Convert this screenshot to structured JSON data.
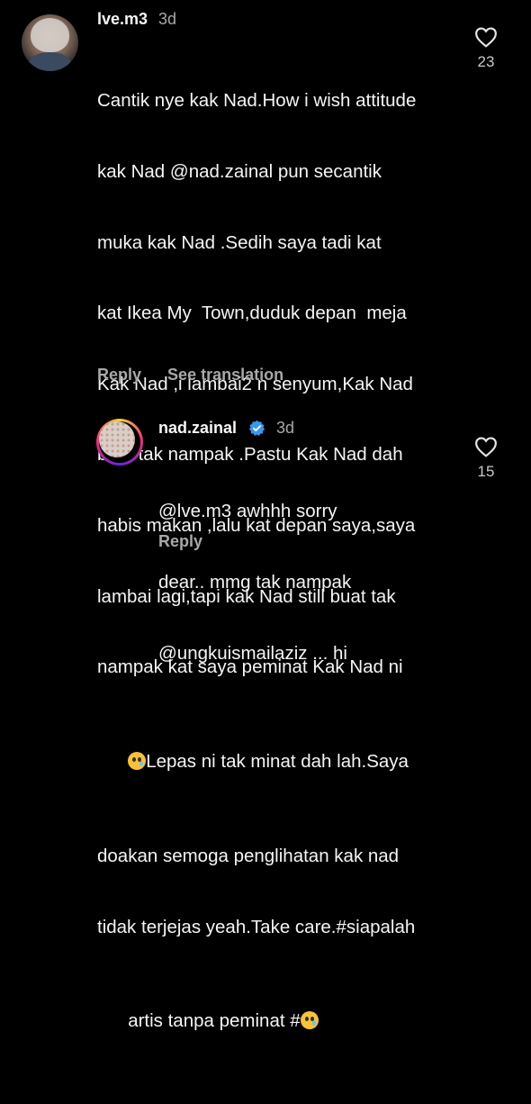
{
  "comment": {
    "username": "lve.m3",
    "time": "3d",
    "text_lines": [
      "Cantik nye kak Nad.How i wish attitude",
      "kak Nad @nad.zainal pun secantik",
      "muka kak Nad .Sedih saya tadi kat",
      "kat Ikea My  Town,duduk depan  meja",
      "Kak Nad ,i lambai2 n senyum,Kak Nad",
      "buat tak nampak .Pastu Kak Nad dah",
      "habis makan ,lalu kat depan saya,saya",
      "lambai lagi,tapi kak Nad still buat tak",
      "nampak kat saya peminat Kak Nad ni",
      "Lepas ni tak minat dah lah.Saya",
      "doakan semoga penglihatan kak nad",
      "tidak terjejas yeah.Take care.#siapalah",
      "artis tanpa peminat #"
    ],
    "like_count": "23",
    "reply_label": "Reply",
    "translation_label": "See translation"
  },
  "reply": {
    "username": "nad.zainal",
    "time": "3d",
    "text_lines": [
      "@lve.m3 awhhh sorry",
      "dear.. mmg tak nampak",
      "@ungkuismailaziz ... hi"
    ],
    "like_count": "15",
    "reply_label": "Reply"
  },
  "colors": {
    "background": "#000000",
    "text": "#f5f5f5",
    "muted": "#a8a8a8",
    "verified": "#3897f0"
  },
  "icons": {
    "like": "heart-outline-icon",
    "verified": "verified-badge-icon",
    "emoji_1": "pleading-face-emoji",
    "emoji_2": "crying-face-emoji"
  }
}
